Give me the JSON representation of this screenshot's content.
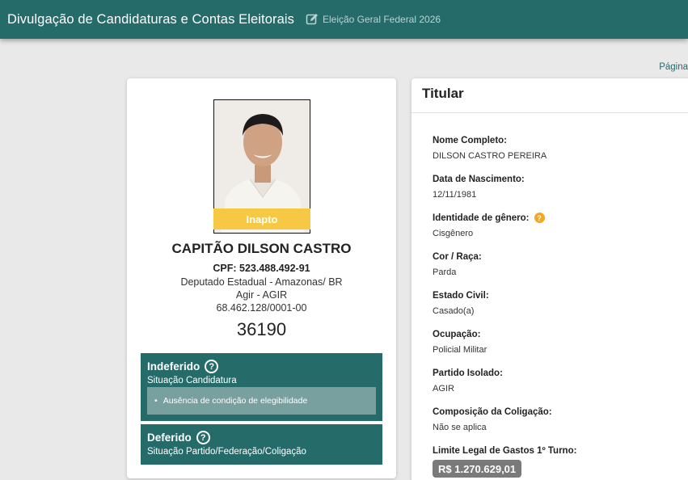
{
  "header": {
    "title": "Divulgação de Candidaturas e Contas Eleitorais",
    "election": "Eleição Geral Federal 2026"
  },
  "pagination_label": "Página",
  "candidate": {
    "photo_badge": "Inapto",
    "name": "CAPITÃO DILSON CASTRO",
    "cpf": "CPF: 523.488.492-91",
    "office": "Deputado Estadual - Amazonas/ BR",
    "party": "Agir - AGIR",
    "cnpj": "68.462.128/0001-00",
    "number": "36190"
  },
  "status": {
    "candidacy": {
      "title": "Indeferido",
      "subtitle": "Situação Candidatura",
      "reason": "Ausência de condição de elegibilidade"
    },
    "party": {
      "title": "Deferido",
      "subtitle": "Situação Partido/Federação/Coligação"
    }
  },
  "details": {
    "section_title": "Titular",
    "fields": [
      {
        "label": "Nome Completo:",
        "value": "DILSON CASTRO PEREIRA"
      },
      {
        "label": "Data de Nascimento:",
        "value": "12/11/1981"
      },
      {
        "label": "Identidade de gênero:",
        "value": "Cisgênero"
      },
      {
        "label": "Cor / Raça:",
        "value": "Parda"
      },
      {
        "label": "Estado Civil:",
        "value": "Casado(a)"
      },
      {
        "label": "Ocupação:",
        "value": "Policial Militar"
      },
      {
        "label": "Partido Isolado:",
        "value": "AGIR"
      },
      {
        "label": "Composição da Coligação:",
        "value": "Não se aplica"
      }
    ],
    "spending_limit_label": "Limite Legal de Gastos 1º Turno:",
    "spending_limit_value": "R$ 1.270.629,01"
  },
  "colors": {
    "primary": "#256b6a",
    "badge": "#f7c843",
    "info": "#f5a623"
  }
}
